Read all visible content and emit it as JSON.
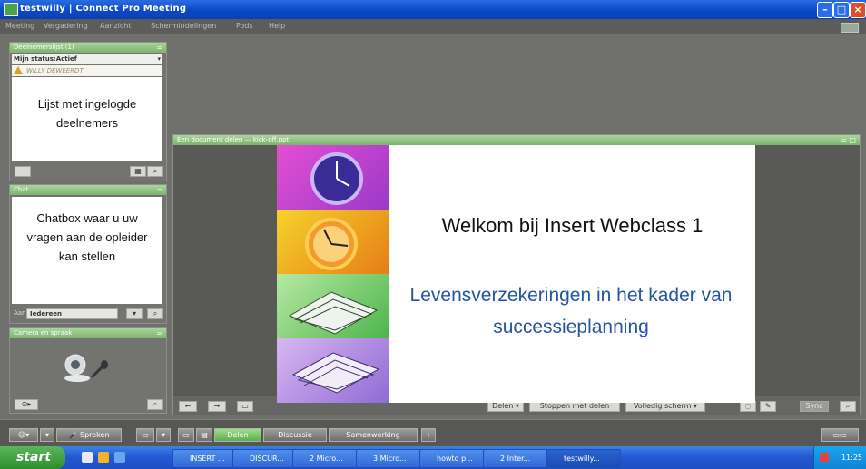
{
  "window": {
    "title": "testwilly | Connect Pro Meeting"
  },
  "menu": {
    "items": [
      "Meeting",
      "Vergadering",
      "Aanzicht",
      "Schermindelingen",
      "Pods",
      "Help"
    ]
  },
  "attendees_pod": {
    "title": "Deelnemerslijst (1)",
    "status": "Mijn status:Actief",
    "attendee": "WILLY DEWEERDT",
    "caption": "Lijst met ingelogde deelnemers"
  },
  "chat_pod": {
    "title": "Chat",
    "caption": "Chatbox waar u uw vragen aan de opleider kan stellen",
    "recipient_label": "Aan:",
    "recipient_value": "Iedereen"
  },
  "camera_pod": {
    "title": "Camera en spraak"
  },
  "share_pod": {
    "title": "Een document delen — kick-off.ppt",
    "slide": {
      "heading": "Welkom bij Insert Webclass 1",
      "subtitle": "Levensverzekeringen in het kader van successieplanning"
    },
    "controls": {
      "share": "Delen",
      "stop": "Stoppen met delen",
      "fullscreen": "Volledig scherm",
      "sync": "Sync"
    }
  },
  "bottom_toolbar": {
    "speak": "Spreken",
    "share": "Delen",
    "discussion": "Discussie",
    "collaboration": "Samenwerking"
  },
  "taskbar": {
    "start": "start",
    "tasks": [
      "INSERT ...",
      "DISCUR...",
      "2 Micro...",
      "3 Micro...",
      "howto p...",
      "2 Inter...",
      "testwilly..."
    ],
    "clock": "11:25"
  },
  "colors": {
    "accent": "#2356a0",
    "title_bar": "#0a49c8",
    "pod_header": "#8cc07c"
  }
}
